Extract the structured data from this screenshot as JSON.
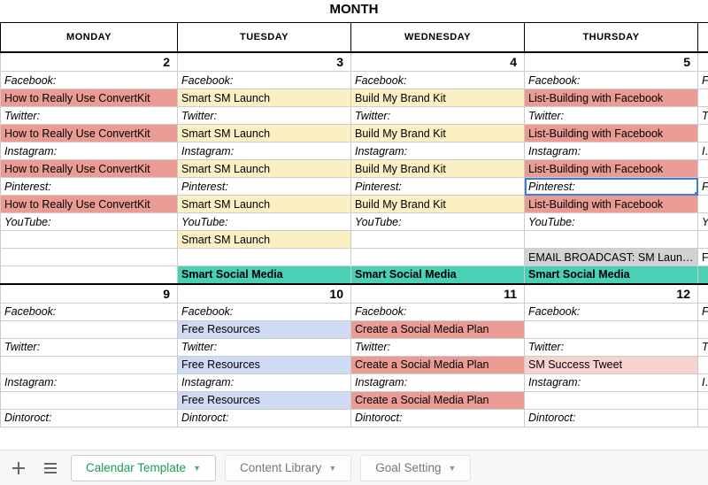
{
  "title": "MONTH",
  "headers": {
    "mon": "MONDAY",
    "tue": "TUESDAY",
    "wed": "WEDNESDAY",
    "thu": "THURSDAY"
  },
  "week1": {
    "date": {
      "mon": "2",
      "tue": "3",
      "wed": "4",
      "thu": "5"
    },
    "platform": {
      "facebook": "Facebook:",
      "twitter": "Twitter:",
      "instagram": "Instagram:",
      "pinterest": "Pinterest:",
      "youtube": "YouTube:",
      "email": "EMAIL BROADCAST: SM Launch"
    },
    "content": {
      "mon_line": "How to Really Use ConvertKit",
      "tue_line": "Smart SM Launch",
      "wed_line": "Build My Brand Kit",
      "thu_line": "List-Building with Facebook",
      "teal": "Smart Social Media"
    }
  },
  "week2": {
    "date": {
      "mon": "9",
      "tue": "10",
      "wed": "11",
      "thu": "12"
    },
    "platform": {
      "facebook": "Facebook:",
      "twitter": "Twitter:",
      "instagram": "Instagram:",
      "pinterest_trunc": "Dintoroct:"
    },
    "content": {
      "tue_line": "Free Resources",
      "wed_line": "Create a Social Media Plan",
      "thu_tw": "SM Success Tweet"
    }
  },
  "tabs": {
    "calendar": "Calendar Template",
    "library": "Content Library",
    "goal": "Goal Setting"
  }
}
